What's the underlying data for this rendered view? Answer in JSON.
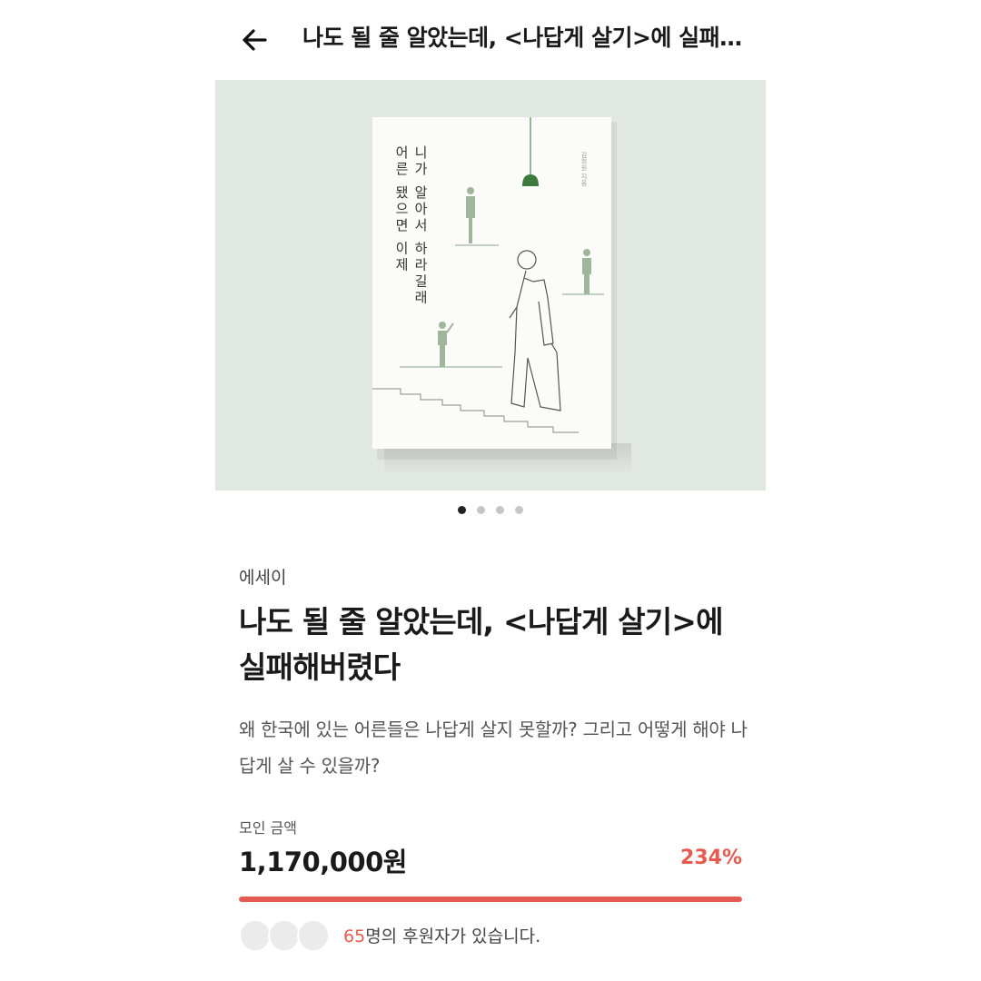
{
  "header": {
    "title": "나도 될 줄 알았는데, <나답게 살기>에 실패해버렸다",
    "back_icon": "arrow-left-icon"
  },
  "hero": {
    "book_title_col1": "니가 알아서 하라길래",
    "book_title_col2": "어른 됐으면 이제",
    "book_author": "김희원 지음",
    "background": "#e1e7e1"
  },
  "carousel": {
    "count": 4,
    "active_index": 0
  },
  "project": {
    "category": "에세이",
    "title": "나도 될 줄 알았는데, <나답게 살기>에 실패해버렸다",
    "summary": "왜 한국에 있는 어른들은 나답게 살지 못할까? 그리고 어떻게 해야 나답게 살 수 있을까?"
  },
  "funding": {
    "amount_label": "모인 금액",
    "amount": "1,170,000원",
    "percent": "234%",
    "progress_fraction": 1.0,
    "accent_color": "#e35b51"
  },
  "supporters": {
    "count": "65",
    "suffix": "명의 후원자가 있습니다."
  }
}
